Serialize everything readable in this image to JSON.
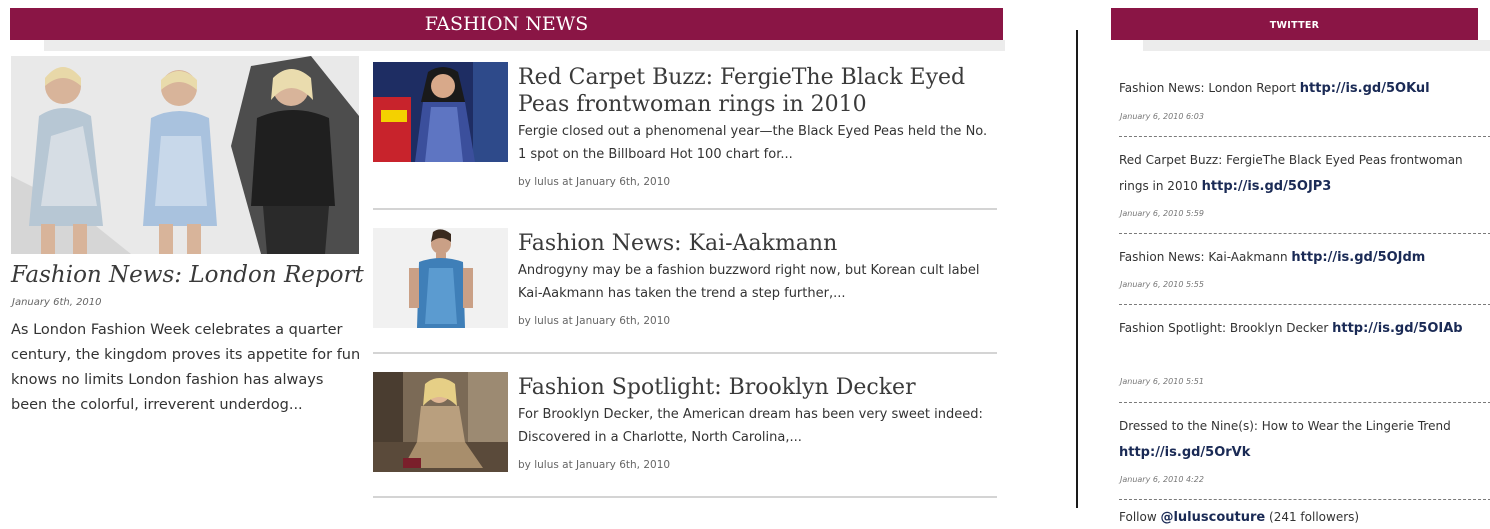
{
  "fashion_news": {
    "header": "FASHION NEWS",
    "featured": {
      "title": "Fashion News: London Report",
      "date": "January 6th, 2010",
      "excerpt": "As London Fashion Week celebrates a quarter century, the kingdom proves its appetite for fun knows no limits London fashion has always been the colorful, irreverent underdog..."
    },
    "stories": [
      {
        "title": "Red Carpet Buzz: FergieThe Black Eyed Peas frontwoman rings in 2010",
        "excerpt": "Fergie closed out a phenomenal year—the Black Eyed Peas held the No. 1 spot on the Billboard Hot 100 chart for...",
        "meta": "by lulus at January 6th, 2010"
      },
      {
        "title": "Fashion News: Kai-Aakmann",
        "excerpt": "Androgyny may be a fashion buzzword right now, but Korean cult label Kai-Aakmann has taken the trend a step further,...",
        "meta": "by lulus at January 6th, 2010"
      },
      {
        "title": "Fashion Spotlight: Brooklyn Decker",
        "excerpt": "For Brooklyn Decker, the American dream has been very sweet indeed: Discovered in a Charlotte, North Carolina,...",
        "meta": "by lulus at January 6th, 2010"
      }
    ]
  },
  "twitter": {
    "header": "TWITTER",
    "tweets": [
      {
        "text": "Fashion News: London Report ",
        "link": "http://is.gd/5OKul",
        "date": "January 6, 2010 6:03"
      },
      {
        "text": "Red Carpet Buzz: FergieThe Black Eyed Peas frontwoman rings in 2010 ",
        "link": "http://is.gd/5OJP3",
        "date": "January 6, 2010 5:59"
      },
      {
        "text": "Fashion News: Kai-Aakmann ",
        "link": "http://is.gd/5OJdm",
        "date": "January 6, 2010 5:55"
      },
      {
        "text": "Fashion Spotlight: Brooklyn Decker ",
        "link": "http://is.gd/5OIAb",
        "date": "January 6, 2010 5:51"
      },
      {
        "text": "Dressed to the Nine(s): How to Wear the Lingerie Trend ",
        "link": "http://is.gd/5OrVk",
        "date": "January 6, 2010 4:22"
      }
    ],
    "follow": {
      "prefix": "Follow ",
      "handle": "@luluscouture",
      "suffix": " (241 followers)"
    }
  },
  "colors": {
    "accent": "#8a1545",
    "link": "#1a2a55"
  }
}
